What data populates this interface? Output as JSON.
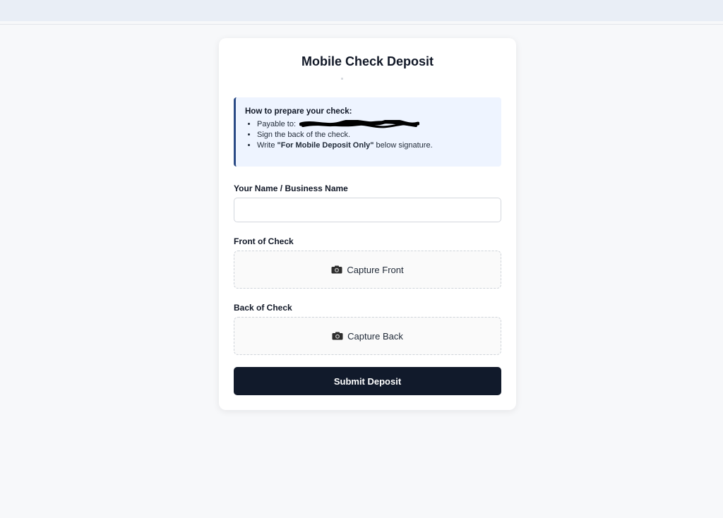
{
  "form": {
    "title": "Mobile Check Deposit",
    "instructions": {
      "title": "How to prepare your check:",
      "items": {
        "payable_prefix": "Payable to:",
        "sign": "Sign the back of the check.",
        "write_prefix": "Write ",
        "write_bold": "\"For Mobile Deposit Only\"",
        "write_suffix": " below signature."
      }
    },
    "name_label": "Your Name / Business Name",
    "name_value": "",
    "front_label": "Front of Check",
    "front_button": "Capture Front",
    "back_label": "Back of Check",
    "back_button": "Capture Back",
    "submit_label": "Submit Deposit"
  },
  "colors": {
    "page_bg": "#f7f8fa",
    "card_bg": "#ffffff",
    "info_bg": "#eef4ff",
    "info_border": "#2b4b86",
    "submit_bg": "#111a2b"
  },
  "icons": {
    "capture": "camera-icon",
    "redaction": "redaction-scribble"
  }
}
